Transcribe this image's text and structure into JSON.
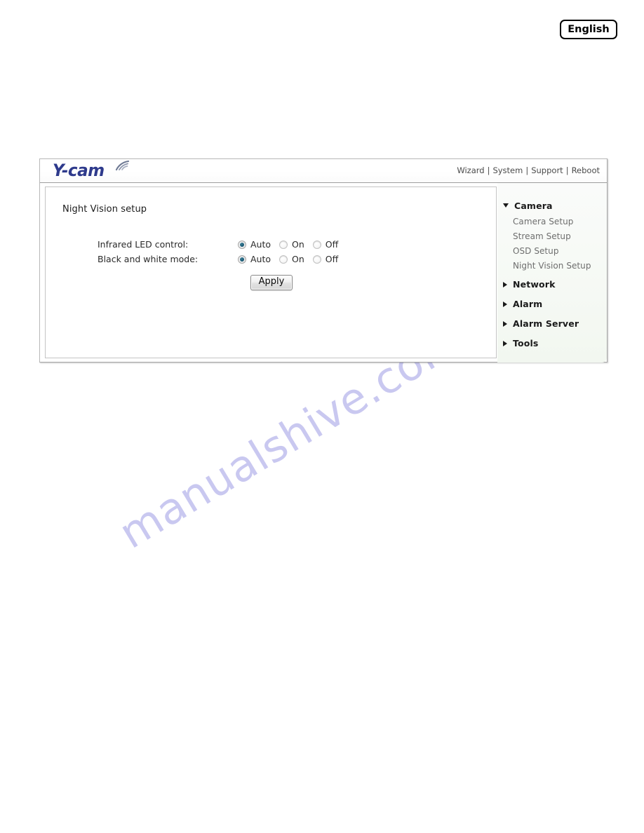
{
  "language_badge": {
    "label": "English"
  },
  "brand": {
    "logo_text": "Y-cam",
    "logo_icon": "wireless-signal-icon"
  },
  "top_nav": {
    "items": [
      {
        "label": "Wizard"
      },
      {
        "label": "System"
      },
      {
        "label": "Support"
      },
      {
        "label": "Reboot"
      }
    ],
    "separator": "|"
  },
  "content": {
    "title": "Night Vision setup",
    "fields": [
      {
        "label": "Infrared LED control:",
        "options": [
          {
            "label": "Auto",
            "selected": true
          },
          {
            "label": "On",
            "selected": false
          },
          {
            "label": "Off",
            "selected": false
          }
        ]
      },
      {
        "label": "Black and white mode:",
        "options": [
          {
            "label": "Auto",
            "selected": true
          },
          {
            "label": "On",
            "selected": false
          },
          {
            "label": "Off",
            "selected": false
          }
        ]
      }
    ],
    "apply_label": "Apply"
  },
  "sidebar": {
    "groups": [
      {
        "label": "Camera",
        "expanded": true,
        "icon": "triangle-down-icon",
        "items": [
          {
            "label": "Camera Setup"
          },
          {
            "label": "Stream Setup"
          },
          {
            "label": "OSD Setup"
          },
          {
            "label": "Night Vision Setup"
          }
        ]
      },
      {
        "label": "Network",
        "expanded": false,
        "icon": "triangle-right-icon",
        "items": []
      },
      {
        "label": "Alarm",
        "expanded": false,
        "icon": "triangle-right-icon",
        "items": []
      },
      {
        "label": "Alarm Server",
        "expanded": false,
        "icon": "triangle-right-icon",
        "items": []
      },
      {
        "label": "Tools",
        "expanded": false,
        "icon": "triangle-right-icon",
        "items": []
      }
    ]
  },
  "watermark": {
    "text": "manualshive.com",
    "color": "#c9c8f0"
  }
}
